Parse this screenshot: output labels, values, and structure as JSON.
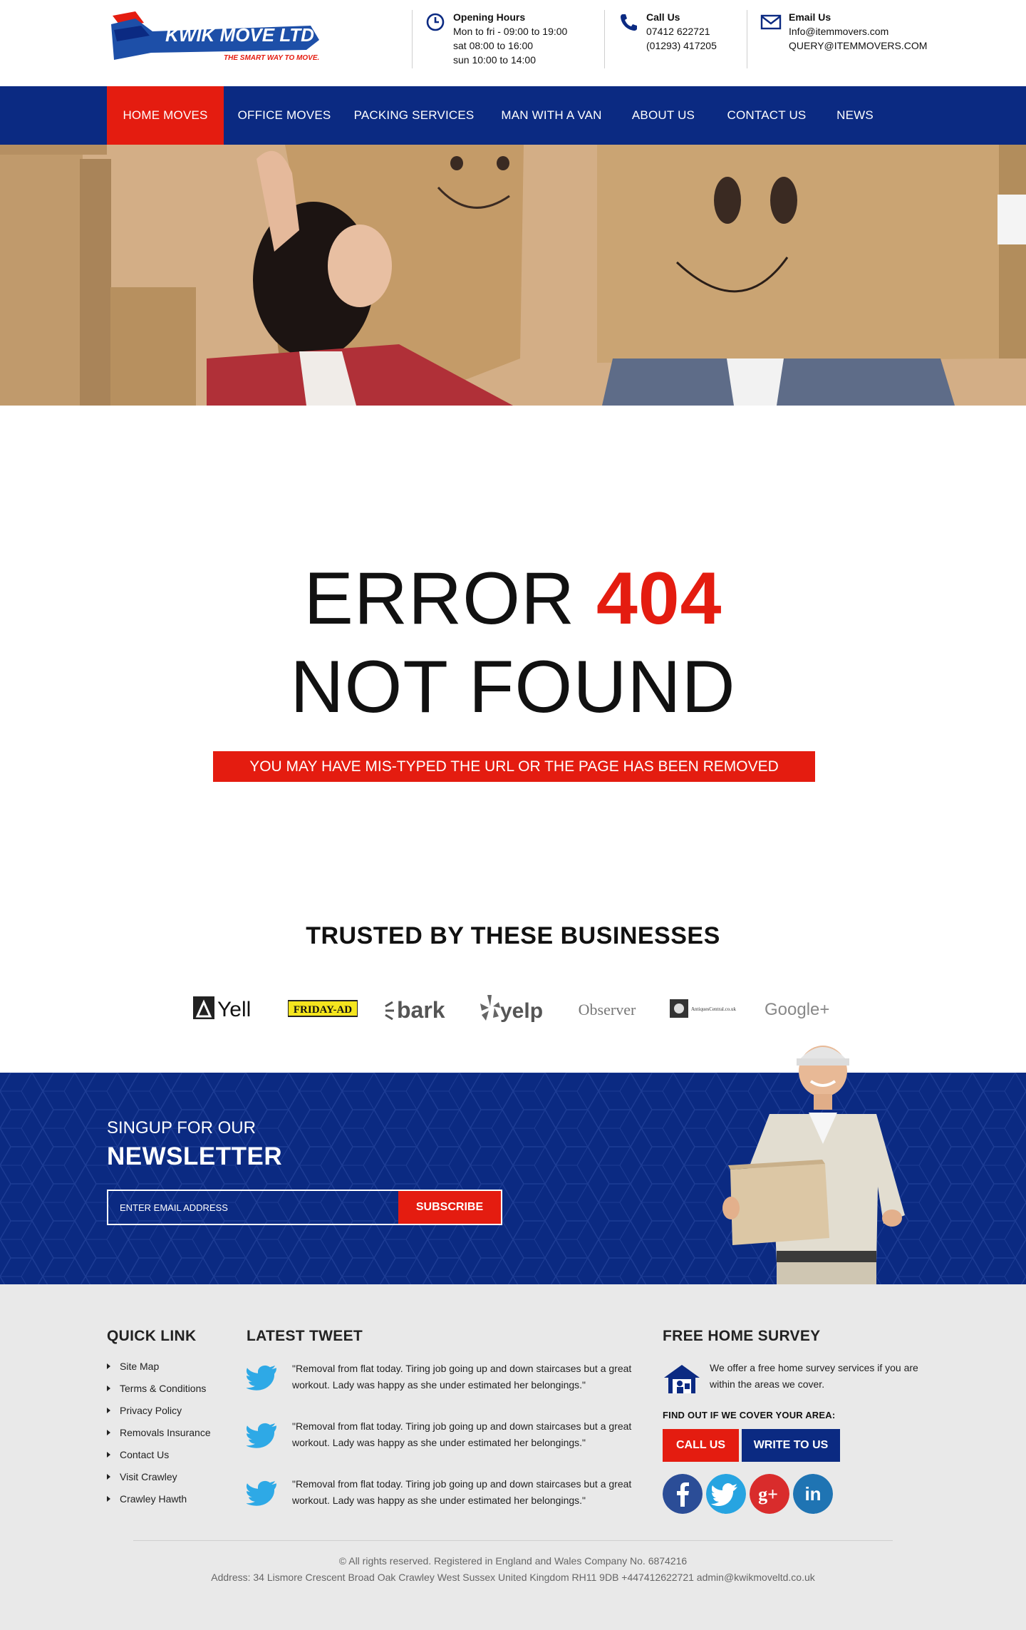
{
  "header": {
    "logo_text": "KWIK MOVE LTD",
    "logo_tagline": "THE SMART WAY TO MOVE.",
    "hours": {
      "title": "Opening Hours",
      "lines": [
        "Mon to fri - 09:00  to 19:00",
        "sat 08:00  to 16:00",
        "sun 10:00 to 14:00"
      ]
    },
    "call": {
      "title": "Call Us",
      "lines": [
        "07412 622721",
        "(01293) 417205"
      ]
    },
    "email": {
      "title": "Email Us",
      "lines": [
        "Info@itemmovers.com",
        "QUERY@ITEMMOVERS.COM"
      ]
    }
  },
  "nav": {
    "items": [
      {
        "label": "HOME MOVES",
        "active": true
      },
      {
        "label": "OFFICE MOVES"
      },
      {
        "label": "PACKING SERVICES"
      },
      {
        "label": "MAN WITH A VAN"
      },
      {
        "label": "ABOUT US"
      },
      {
        "label": "CONTACT US"
      },
      {
        "label": "NEWS"
      }
    ]
  },
  "error": {
    "prefix": "ERROR",
    "code": "404",
    "subtitle": "NOT FOUND",
    "message": "YOU MAY HAVE MIS-TYPED THE URL OR THE PAGE HAS BEEN REMOVED"
  },
  "trusted": {
    "title": "TRUSTED BY THESE BUSINESSES",
    "brands": [
      "Yell",
      "FRIDAY-AD",
      "bark",
      "yelp",
      "Observer",
      "AntiquesCentral.co.uk",
      "Google+"
    ]
  },
  "newsletter": {
    "small": "SINGUP FOR OUR",
    "big": "NEWSLETTER",
    "placeholder": "ENTER EMAIL ADDRESS",
    "button": "SUBSCRIBE"
  },
  "footer": {
    "quick_link": {
      "title": "QUICK LINK",
      "items": [
        "Site Map",
        "Terms & Conditions",
        "Privacy Policy",
        "Removals Insurance",
        "Contact Us",
        "Visit Crawley",
        "Crawley Hawth"
      ]
    },
    "latest_tweet": {
      "title": "LATEST TWEET",
      "tweets": [
        "\"Removal from flat today. Tiring job going up and down staircases but a great workout. Lady was happy as she under estimated her belongings.\"",
        "\"Removal from flat today. Tiring job going up and down staircases but a great workout. Lady was happy as she under estimated her belongings.\"",
        "\"Removal from flat today. Tiring job going up and down staircases but a great workout. Lady was happy as she under estimated her belongings.\""
      ]
    },
    "survey": {
      "title": "FREE HOME SURVEY",
      "text": "We offer a free home survey services if you are within the areas we cover.",
      "find_out": "FIND OUT IF WE COVER YOUR AREA:",
      "call_btn": "CALL US",
      "write_btn": "WRITE TO US"
    },
    "social": [
      "facebook-icon",
      "twitter-icon",
      "google-plus-icon",
      "linkedin-icon"
    ],
    "copyright": "© All rights reserved. Registered in England and Wales Company No. 6874216",
    "address": "Address: 34 Lismore Crescent Broad Oak Crawley West Sussex United Kingdom RH11 9DB +447412622721 admin@kwikmoveltd.co.uk"
  },
  "colors": {
    "brand_blue": "#0b2a82",
    "accent_red": "#e41c10",
    "footer_bg": "#e9e9e9"
  }
}
